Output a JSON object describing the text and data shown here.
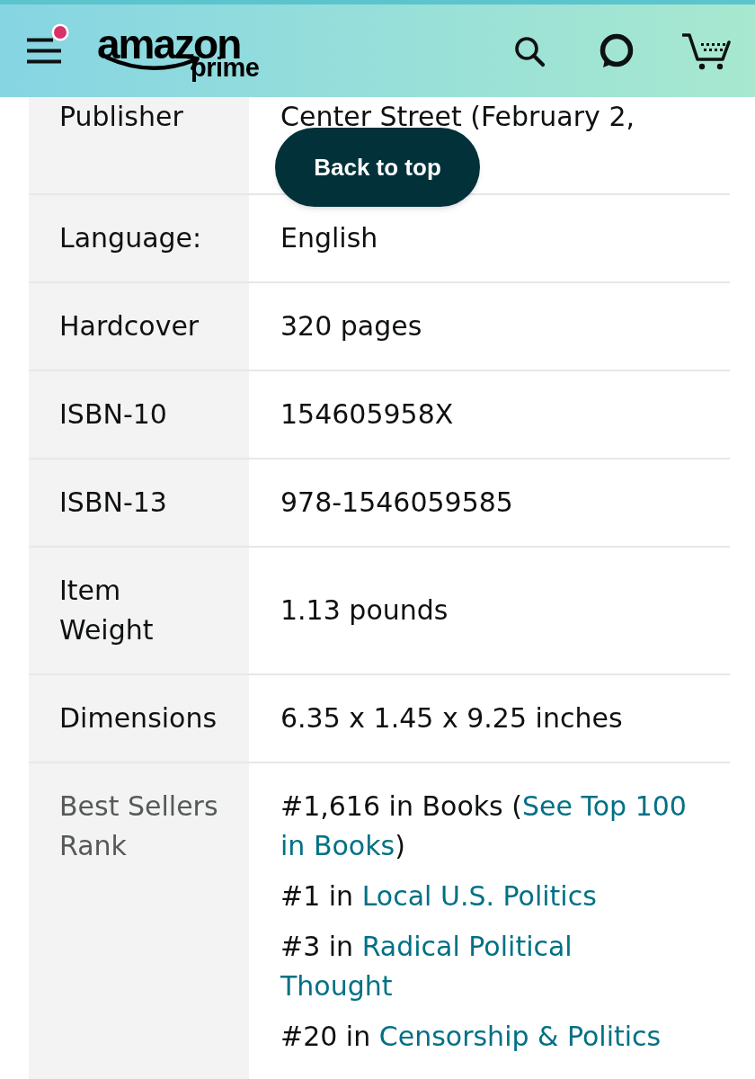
{
  "header": {
    "logo": "amazon",
    "logo_sub": "prime",
    "menu_notification": true
  },
  "details": [
    {
      "label": "Publisher",
      "value": "Center Street (February 2,"
    },
    {
      "label": "Language:",
      "value": "English"
    },
    {
      "label": "Hardcover",
      "value": "320 pages"
    },
    {
      "label": "ISBN-10",
      "value": "154605958X"
    },
    {
      "label": "ISBN-13",
      "value": "978-1546059585"
    },
    {
      "label": "Item Weight",
      "value": "1.13 pounds"
    },
    {
      "label": "Dimensions",
      "value": "6.35 x 1.45 x 9.25 inches"
    }
  ],
  "best_sellers_rank": {
    "label": "Best Sellers Rank",
    "entries": [
      {
        "rank": "#1,616 in Books",
        "open": "(",
        "link_lines": [
          "See Top 100",
          "in Books"
        ],
        "close": ")"
      },
      {
        "rank": "#1 in",
        "link_lines": [
          "Local U.S. Politics"
        ]
      },
      {
        "rank": "#3 in",
        "link_lines": [
          "Radical Political",
          "Thought"
        ]
      },
      {
        "rank": "#20 in",
        "link_lines": [
          "Censorship & Politics"
        ]
      }
    ]
  },
  "back_to_top": "Back to top"
}
